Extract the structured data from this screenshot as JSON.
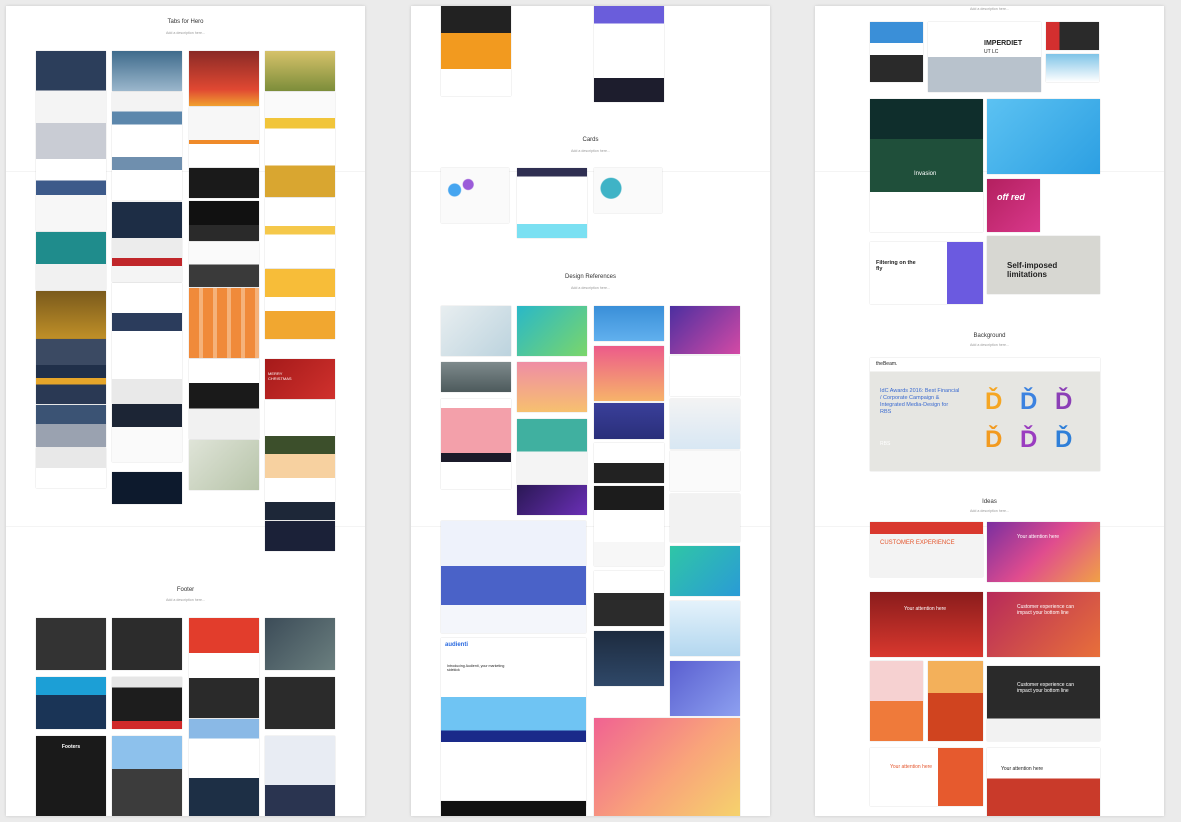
{
  "boards": [
    {
      "sections": [
        {
          "title": "Tabs for Hero",
          "desc": "Add a description here..."
        },
        {
          "title": "Footer",
          "desc": "Add a description here..."
        }
      ]
    },
    {
      "sections": [
        {
          "title": "Cards",
          "desc": "Add a description here..."
        },
        {
          "title": "Design References",
          "desc": "Add a description here..."
        }
      ]
    },
    {
      "sections": [
        {
          "title": "Background",
          "desc": "Add a description here..."
        },
        {
          "title": "Ideas",
          "desc": "Add a description here..."
        }
      ],
      "top_desc": "Add a description here..."
    }
  ],
  "texts": {
    "imperdiet": "IMPERDIET",
    "imperdiet_sub": "UT LC",
    "invasion": "Invasion",
    "offred": "off red",
    "filtering": "Filtering on the fly",
    "self_imposed": "Self-imposed limitations",
    "idc": "IdC Awards 2016: Best Financial / Corporate Campaign & Integrated Media-Design for RBS",
    "thebeam": "theBeam.",
    "rbs": "RBS",
    "customer_exp": "CUSTOMER EXPERIENCE",
    "attention": "Your attention here",
    "customer_impact": "Customer experience can impact your bottom line",
    "audienti": "audienti",
    "audienti_head": "Introducing Audienti, your marketing sidekick",
    "footers": "Footers",
    "merry": "MERRY CHRISTMAS"
  },
  "colors": {
    "accent_blue": "#3a8fd8",
    "orange": "#f29a1f",
    "purple": "#6b2fb3",
    "red": "#d9342b"
  }
}
